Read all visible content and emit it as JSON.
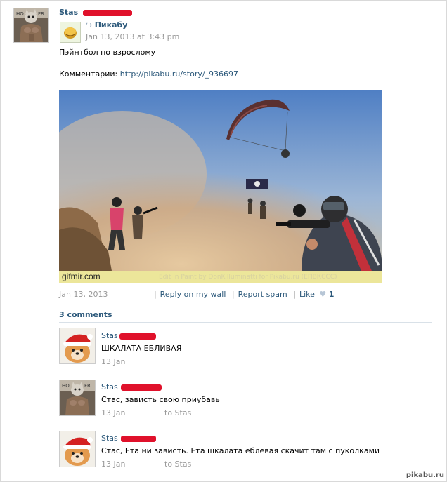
{
  "post": {
    "author": "Stas",
    "repost_group": "Пикабу",
    "repost_date": "Jan 13, 2013 at 3:43 pm",
    "text": "Пэйнтбол по взрослому",
    "comments_label": "Комментарии:",
    "comments_link": "http://pikabu.ru/story/_936697",
    "image": {
      "caption_left": "gifmir.com",
      "caption_right": "Edit in Paint by DonKilluminatti for Pikabu.ru (ЕПВКССС)"
    },
    "date": "Jan 13, 2013",
    "reply_link": "Reply on my wall",
    "report_link": "Report spam",
    "like_label": "Like",
    "like_count": "1",
    "comments_count": "3 comments"
  },
  "comments": [
    {
      "author": "Stas",
      "text": "ШКАЛАТА ЕБЛИВАЯ",
      "date": "13 Jan",
      "to": ""
    },
    {
      "author": "Stas",
      "text": "Стас, зависть свою приубавь",
      "date": "13 Jan",
      "to": "to Stas"
    },
    {
      "author": "Stas",
      "text": "Стас, Ета ни зависть. Ета шкалата еблевая скачит там с пуколками",
      "date": "13 Jan",
      "to": "to Stas"
    }
  ],
  "watermark": "pikabu.ru"
}
